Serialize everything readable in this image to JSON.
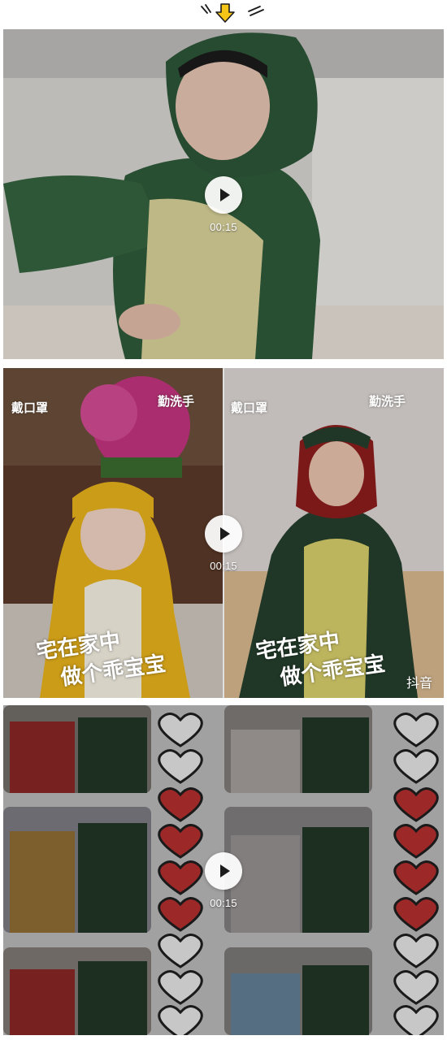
{
  "header": {
    "icon": "down-arrow-icon"
  },
  "videos": [
    {
      "duration": "00:15"
    },
    {
      "duration": "00:15",
      "tags": {
        "mask": "戴口罩",
        "wash": "勤洗手"
      },
      "caption_line1": "宅在家中",
      "caption_line2": "做个乖宝宝",
      "watermark": "抖音"
    },
    {
      "duration": "00:15"
    }
  ],
  "colors": {
    "accent": "#f5c518",
    "dino_green": "#2f5a3a",
    "hood_yellow": "#e8b21c"
  }
}
